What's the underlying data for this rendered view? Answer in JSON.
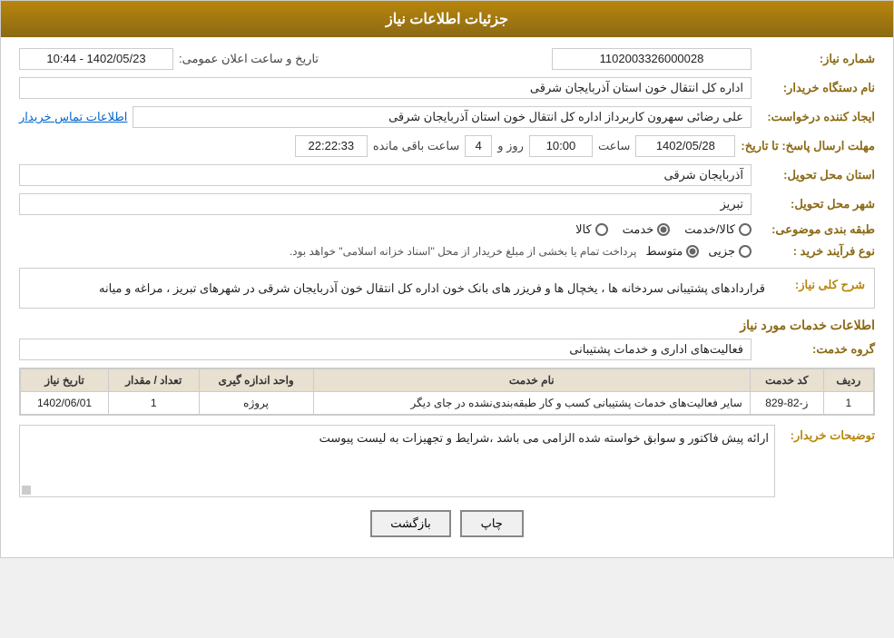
{
  "header": {
    "title": "جزئیات اطلاعات نیاز"
  },
  "fields": {
    "request_number_label": "شماره نیاز:",
    "request_number_value": "1102003326000028",
    "announcement_date_label": "تاریخ و ساعت اعلان عمومی:",
    "announcement_date_value": "1402/05/23 - 10:44",
    "buyer_org_label": "نام دستگاه خریدار:",
    "buyer_org_value": "اداره کل انتقال خون استان آذربایجان شرقی",
    "requester_label": "ایجاد کننده درخواست:",
    "requester_value": "علی رضائی سهرون کاربرداز اداره کل انتقال خون استان آذربایجان شرقی",
    "contact_link": "اطلاعات تماس خریدار",
    "response_deadline_label": "مهلت ارسال پاسخ: تا تاریخ:",
    "response_date_value": "1402/05/28",
    "response_time_label": "ساعت",
    "response_time_value": "10:00",
    "response_days_label": "روز و",
    "response_days_value": "4",
    "response_remaining_label": "ساعت باقی مانده",
    "response_remaining_value": "22:22:33",
    "delivery_province_label": "استان محل تحویل:",
    "delivery_province_value": "آذربایجان شرقی",
    "delivery_city_label": "شهر محل تحویل:",
    "delivery_city_value": "تبریز",
    "category_label": "طبقه بندی موضوعی:",
    "category_options": [
      {
        "label": "کالا",
        "selected": false
      },
      {
        "label": "خدمت",
        "selected": true
      },
      {
        "label": "کالا/خدمت",
        "selected": false
      }
    ],
    "purchase_type_label": "نوع فرآیند خرید :",
    "purchase_type_options": [
      {
        "label": "جزیی",
        "selected": false
      },
      {
        "label": "متوسط",
        "selected": true
      }
    ],
    "purchase_type_note": "پرداخت تمام یا بخشی از مبلغ خریدار از محل \"اسناد خزانه اسلامی\" خواهد بود.",
    "general_desc_label": "شرح کلی نیاز:",
    "general_desc_value": "قراردادهای پشتیبانی سردخانه ها ، یخچال ها و فریزر های بانک خون اداره کل انتقال خون آذربایجان شرقی در شهرهای تبریز ، مراغه و میانه",
    "services_section_title": "اطلاعات خدمات مورد نیاز",
    "service_group_label": "گروه خدمت:",
    "service_group_value": "فعالیت‌های اداری و خدمات پشتیبانی",
    "table": {
      "headers": [
        "ردیف",
        "کد خدمت",
        "نام خدمت",
        "واحد اندازه گیری",
        "تعداد / مقدار",
        "تاریخ نیاز"
      ],
      "rows": [
        {
          "row_num": "1",
          "service_code": "ز-82-829",
          "service_name": "سایر فعالیت‌های خدمات پشتیبانی کسب و کار طبقه‌بندی‌نشده در جای دیگر",
          "unit": "پروژه",
          "quantity": "1",
          "date": "1402/06/01"
        }
      ]
    },
    "buyer_notes_label": "توضیحات خریدار:",
    "buyer_notes_value": "ارائه پیش فاکتور و سوابق خواسته شده الزامی می باشد ،شرایط و تجهیزات به لیست پیوست"
  },
  "buttons": {
    "print_label": "چاپ",
    "back_label": "بازگشت"
  }
}
